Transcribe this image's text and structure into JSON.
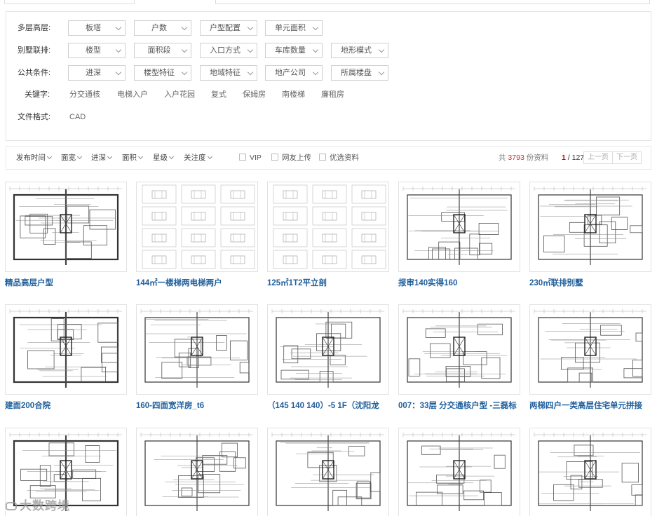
{
  "filters": {
    "rows": [
      {
        "label": "多层高层:",
        "selects": [
          "板塔",
          "户数",
          "户型配置",
          "单元面积"
        ]
      },
      {
        "label": "别墅联排:",
        "selects": [
          "楼型",
          "面积段",
          "入口方式",
          "车库数量",
          "地形模式"
        ]
      },
      {
        "label": "公共条件:",
        "selects": [
          "进深",
          "楼型特征",
          "地域特征",
          "地产公司",
          "所属楼盘"
        ]
      }
    ],
    "keywords_label": "关键字:",
    "keywords": [
      "分交通核",
      "电梯入户",
      "入户花园",
      "复式",
      "保姆房",
      "南楼梯",
      "廉租房"
    ],
    "format_label": "文件格式:",
    "format_value": "CAD"
  },
  "sortbar": {
    "sorts": [
      "发布时间",
      "面宽",
      "进深",
      "面积",
      "星级",
      "关注度"
    ],
    "checks": [
      "VIP",
      "网友上传",
      "优选资料"
    ],
    "total_prefix": "共",
    "total_count": "3793",
    "total_suffix": "份资料",
    "page_current": "1",
    "page_sep": "/",
    "page_total": "127",
    "prev_label": "上一页",
    "next_label": "下一页"
  },
  "cards": [
    {
      "title": "精品高层户型"
    },
    {
      "title": "144㎡一楼梯两电梯两户"
    },
    {
      "title": "125㎡1T2平立剖"
    },
    {
      "title": "报审140实得160"
    },
    {
      "title": "230㎡联排别墅"
    },
    {
      "title": "建面200合院"
    },
    {
      "title": "160-四面宽洋房_t6"
    },
    {
      "title": "（145 140 140）-5 1F（沈阳龙"
    },
    {
      "title": "007：33层 分交通核户型 -三磊标"
    },
    {
      "title": "两梯四户一类高层住宅单元拼接"
    },
    {
      "title": ""
    },
    {
      "title": ""
    },
    {
      "title": ""
    },
    {
      "title": ""
    },
    {
      "title": ""
    }
  ],
  "watermark": "大数跨境"
}
